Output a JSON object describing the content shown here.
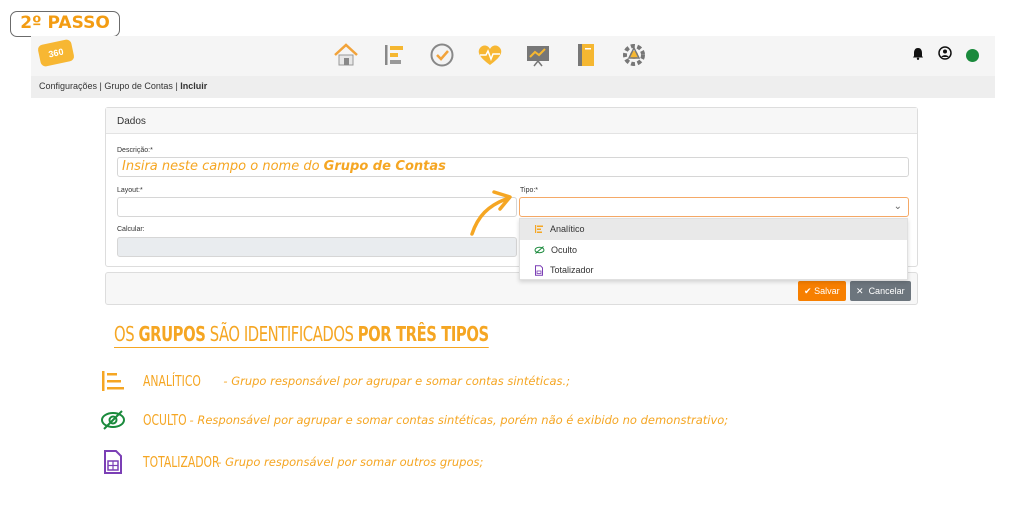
{
  "step_badge": "2º PASSO",
  "nav": {
    "logo_text": "360",
    "icons": [
      "home-icon",
      "structure-icon",
      "check-circle-icon",
      "heart-pulse-icon",
      "chart-board-icon",
      "notebook-icon",
      "gear-network-icon"
    ],
    "status_color": "#1a8a3c"
  },
  "breadcrumb": {
    "part1": "Configurações",
    "part2": "Grupo de Contas",
    "current": "Incluir"
  },
  "form": {
    "header": "Dados",
    "descricao_label": "Descrição:*",
    "descricao_hint_prefix": "Insira neste campo o nome do ",
    "descricao_hint_bold": "Grupo de Contas",
    "layout_label": "Layout:*",
    "tipo_label": "Tipo:*",
    "calcular_label": "Calcular:"
  },
  "dropdown": {
    "options": [
      "Analítico",
      "Oculto",
      "Totalizador"
    ],
    "highlighted": "Analítico"
  },
  "buttons": {
    "save": "Salvar",
    "cancel": "Cancelar"
  },
  "headline": {
    "p1": "OS ",
    "p2": "GRUPOS",
    "p3": " SÃO IDENTIFICADOS ",
    "p4": "POR TRÊS TIPOS"
  },
  "types": [
    {
      "name": "ANALÍTICO",
      "desc": " - Grupo responsável por agrupar e somar contas sintéticas.;"
    },
    {
      "name": "OCULTO",
      "desc": " - Responsável por agrupar e somar contas sintéticas, porém não é exibido no demonstrativo;"
    },
    {
      "name": "TOTALIZADOR",
      "desc": " - Grupo responsável por somar outros grupos;"
    }
  ],
  "colors": {
    "accent": "#f5a623",
    "save_button": "#f77f00",
    "cancel_button": "#6c757d"
  }
}
